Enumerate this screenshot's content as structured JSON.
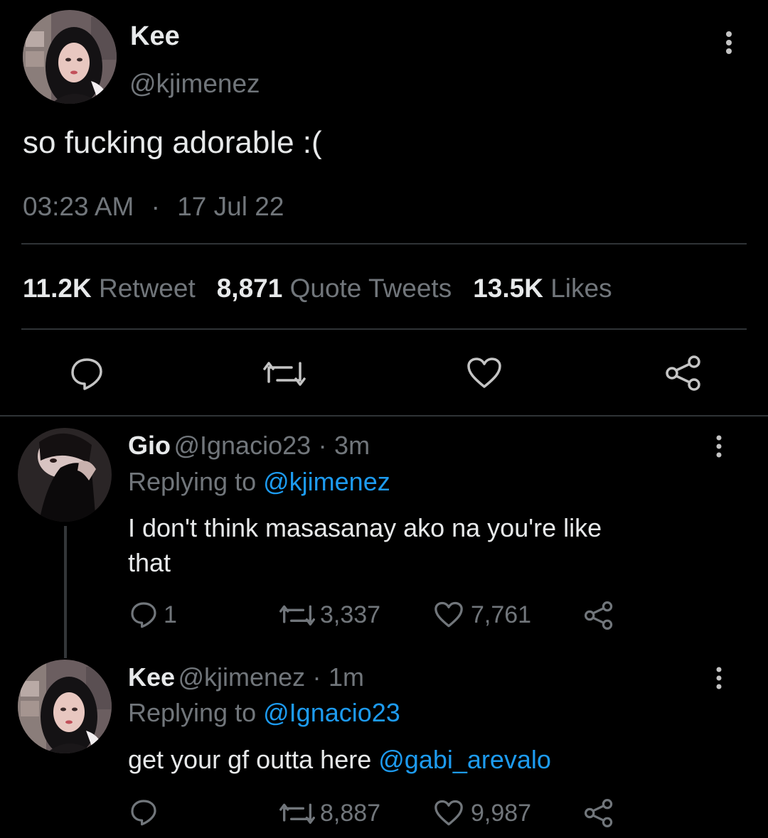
{
  "main_tweet": {
    "name": "Kee",
    "handle": "@kjimenez",
    "text": "so fucking adorable :(",
    "time": "03:23 AM",
    "dot": "·",
    "date": "17 Jul 22",
    "stats": {
      "retweets": "11.2K",
      "retweets_label": "Retweet",
      "quotes": "8,871",
      "quotes_label": "Quote Tweets",
      "likes": "13.5K",
      "likes_label": "Likes"
    },
    "actions": [
      "reply-icon",
      "retweet-icon",
      "heart-icon",
      "share-icon"
    ]
  },
  "replies": [
    {
      "name": "Gio",
      "handle": "@Ignacio23",
      "dot": "·",
      "age": "3m",
      "replying_prefix": "Replying to",
      "replying_to": "@kjimenez",
      "text_line1": "I don't think masasanay ako na you're like",
      "text_line2": "that",
      "reply_count": "1",
      "retweet_count": "3,337",
      "like_count": "7,761"
    },
    {
      "name": "Kee",
      "handle": "@kjimenez",
      "dot": "·",
      "age": "1m",
      "replying_prefix": "Replying to",
      "replying_to": "@Ignacio23",
      "text": "get your gf outta here",
      "mention": "@gabi_arevalo",
      "retweet_count": "8,887",
      "like_count": "9,987"
    }
  ],
  "colors": {
    "background": "#000000",
    "text": "#e7e9ea",
    "muted": "#71767b",
    "link": "#1d9bf0",
    "divider": "#2f3336"
  }
}
